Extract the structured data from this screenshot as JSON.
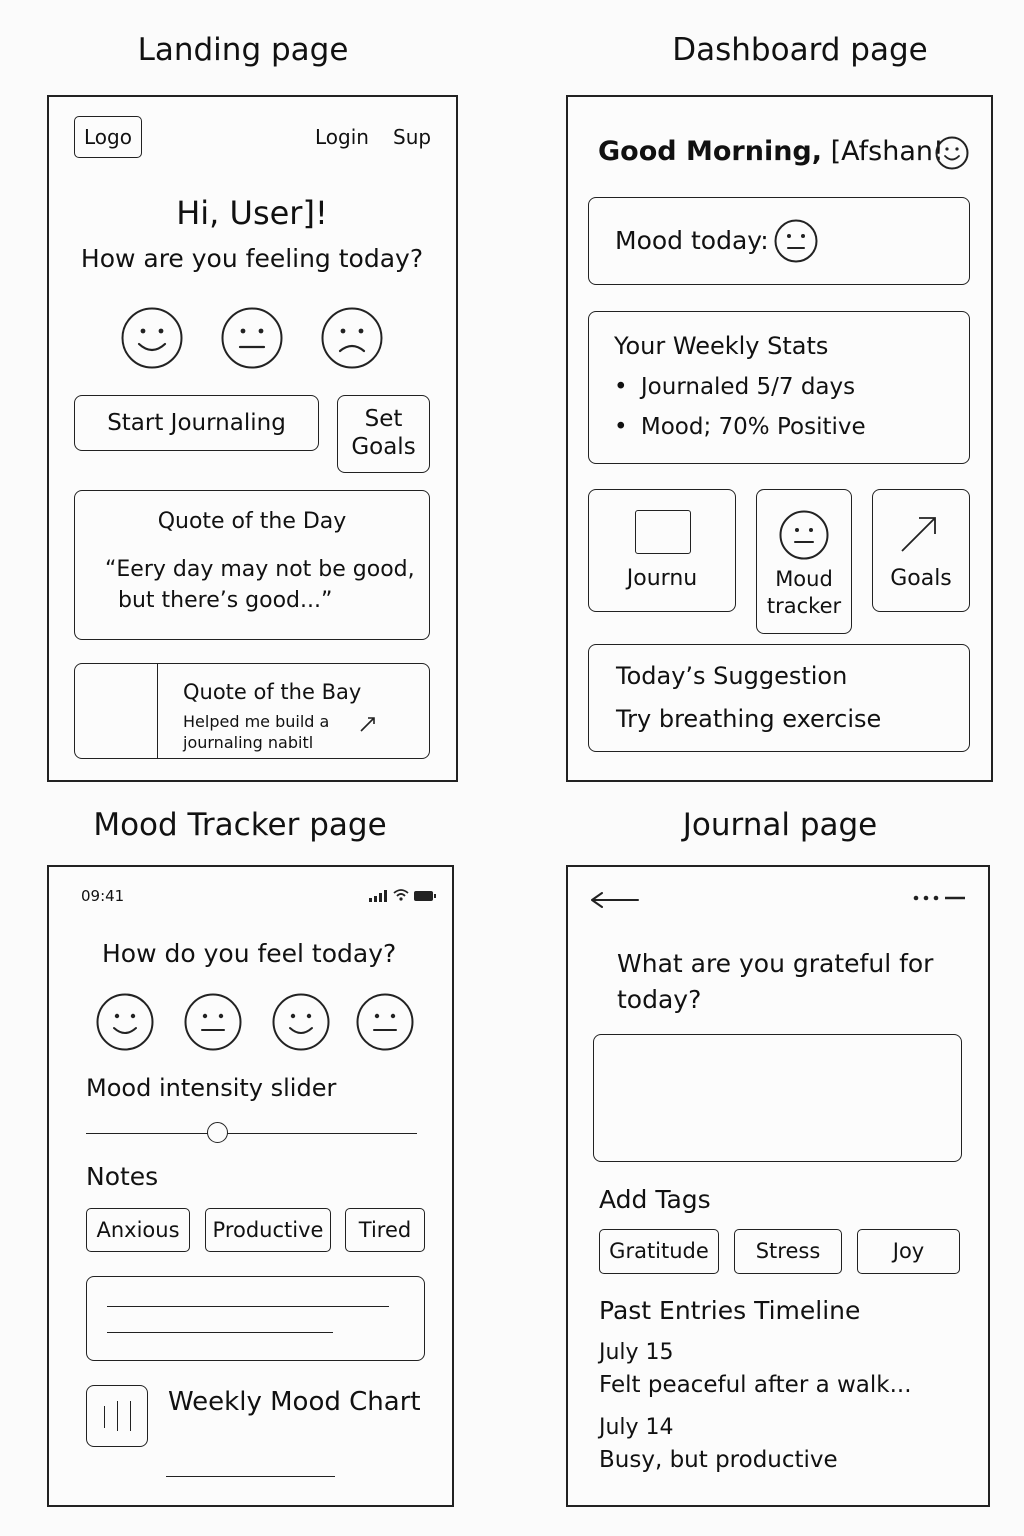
{
  "titles": {
    "landing": "Landing page",
    "dashboard": "Dashboard page",
    "mood": "Mood Tracker page",
    "journal": "Journal page"
  },
  "landing": {
    "logo": "Logo",
    "nav": {
      "login": "Login",
      "signup": "Sup"
    },
    "greeting": "Hi, User]!",
    "question": "How are you feeling today?",
    "moods": [
      "happy-face-icon",
      "neutral-face-icon",
      "sad-face-icon"
    ],
    "start_journaling": "Start Journaling",
    "set_goals": [
      "Set",
      "Goals"
    ],
    "quote": {
      "title": "Quote of the Day",
      "line1": "“Eery day may not be good,",
      "line2": "but there’s good...”"
    },
    "testimonial": {
      "title": "Quote of the Bay",
      "line1": "Helped me build a",
      "line2": "journaling nabitl"
    }
  },
  "dashboard": {
    "greeting_bold": "Good Morning,",
    "greeting_name": "[Afshan!",
    "mood_label": "Mood today:",
    "stats": {
      "title": "Your Weekly Stats",
      "items": [
        "Journaled 5/7 days",
        "Mood; 70% Positive"
      ]
    },
    "tiles": {
      "journal": "Journu",
      "mood": [
        "Moud",
        "tracker"
      ],
      "goals": "Goals"
    },
    "suggestion": {
      "title": "Today’s Suggestion",
      "text": "Try breathing exercise"
    }
  },
  "mood_tracker": {
    "time": "09:41",
    "question": "How do you feel today?",
    "faces": [
      "smile-face-icon",
      "neutral-face-icon",
      "smile-face-icon",
      "neutral-face-icon"
    ],
    "slider_label": "Mood intensity slider",
    "slider_value": 0.39,
    "notes_label": "Notes",
    "tags": [
      "Anxious",
      "Productive",
      "Tired"
    ],
    "chart_label": "Weekly Mood Chart"
  },
  "journal": {
    "prompt_line1": "What are you grateful for",
    "prompt_line2": "today?",
    "add_tags": "Add Tags",
    "tags": [
      "Gratitude",
      "Stress",
      "Joy"
    ],
    "timeline_title": "Past Entries Timeline",
    "entries": [
      {
        "date": "July 15",
        "text": "Felt peaceful after a walk..."
      },
      {
        "date": "July 14",
        "text": "Busy, but productive"
      }
    ]
  }
}
